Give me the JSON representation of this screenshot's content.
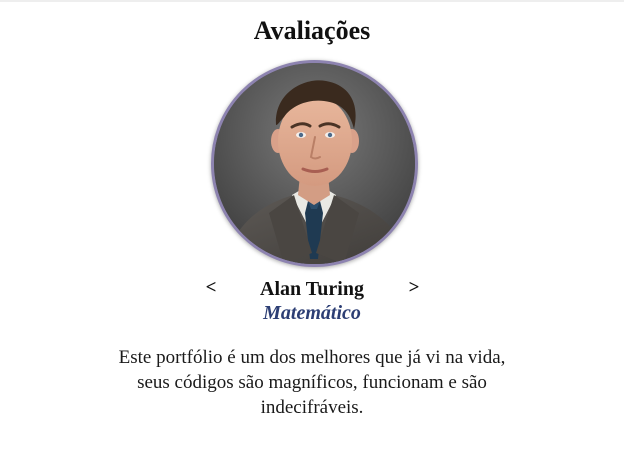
{
  "testimonials": {
    "title": "Avaliações",
    "prev_label": "<",
    "next_label": ">",
    "current": {
      "name": "Alan Turing",
      "role": "Matemático",
      "quote": "Este portfólio é um dos melhores que já vi na vida, seus códigos são magníficos, funcionam e são indecifráveis."
    }
  },
  "colors": {
    "role_text": "#2c3e74",
    "photo_border": "#8d83b0",
    "text": "#111111",
    "background": "#ffffff"
  }
}
